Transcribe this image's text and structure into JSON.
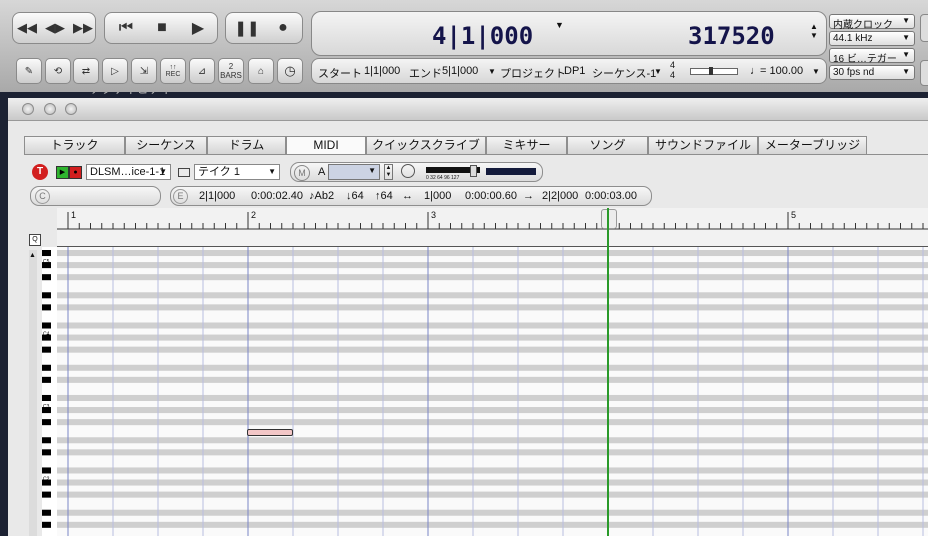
{
  "transport": {
    "position": "4|1|000",
    "samples": "317520",
    "info": {
      "start_label": "スタート",
      "start_value": "1|1|000",
      "end_label": "エンド",
      "end_value": "5|1|000",
      "project_label": "プロジェクト",
      "project_value": "DP1",
      "sequence": "シーケンス-1",
      "meter_top": "4",
      "meter_bottom": "4",
      "tempo_symbol": "♩",
      "tempo": "= 100.00"
    },
    "clock": "内蔵クロック",
    "sample_rate": "44.1 kHz",
    "bit_depth": "16 ビ…テガー",
    "frame_rate": "30 fps nd",
    "tool_bars_number": "2",
    "tool_bars_label": "BARS",
    "tool_rec_label": "REC"
  },
  "tabs": [
    "トラック",
    "シーケンス",
    "ドラム",
    "MIDI",
    "クイックスクライブ",
    "ミキサー",
    "ソング",
    "サウンドファイル",
    "メーターブリッジ"
  ],
  "active_tab": "MIDI",
  "midi_toolbar": {
    "t_label": "T",
    "instrument": "DLSM…ice-1-1",
    "take": "テイク 1",
    "m_label": "M",
    "a_label": "A",
    "level_scale": "0  32  64  96 127",
    "c_label": "C",
    "e_label": "E"
  },
  "event": {
    "position": "2|1|000",
    "time": "0:00:02.40",
    "pitch": "♪Ab2",
    "velocity_on": "↓64",
    "velocity_off": "↑64",
    "duration_icon": "↔",
    "duration": "1|000",
    "duration_time": "0:00:00.60",
    "end_arrow": "→",
    "end": "2|2|000",
    "end_time": "0:00:03.00"
  },
  "ruler": {
    "bars": [
      "1",
      "2",
      "3",
      "4",
      "5"
    ]
  },
  "keyboard": {
    "octave_labels": [
      "C5",
      "C4",
      "C3",
      "C2"
    ]
  },
  "zoom_icon": "Q",
  "background_text": "アクティビティ",
  "colors": {
    "track_enabled": "#d21f1f",
    "play_green": "#2fb42f",
    "playhead": "#2a9a2a",
    "note": "#f3c7c7"
  }
}
